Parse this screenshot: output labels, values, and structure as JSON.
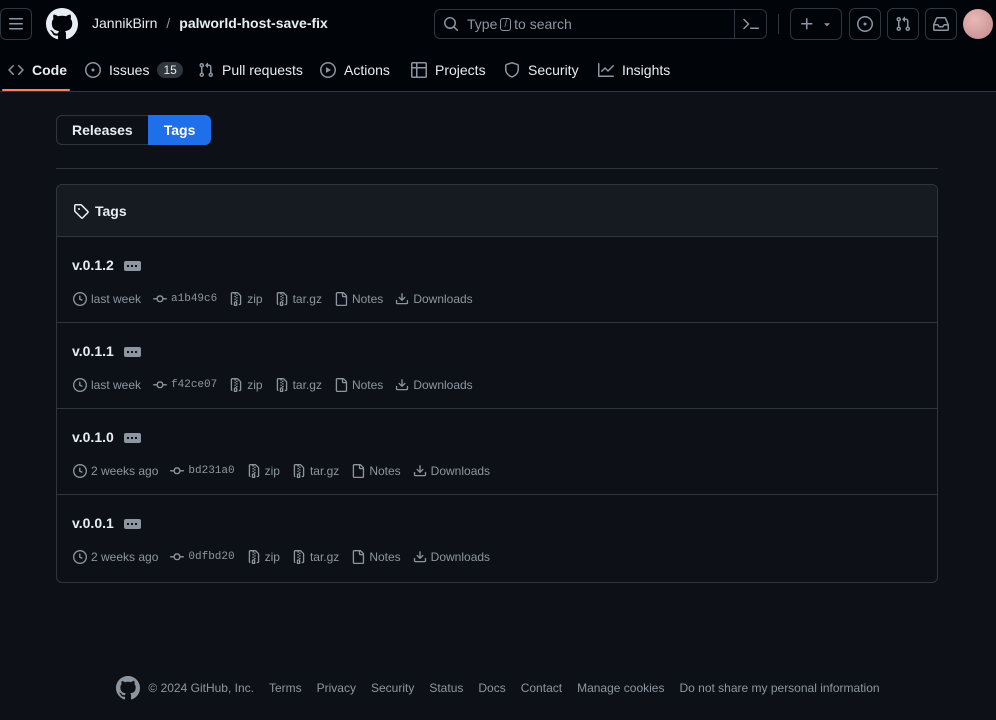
{
  "header": {
    "owner": "JannikBirn",
    "separator": "/",
    "repo": "palworld-host-save-fix",
    "search_prefix": "Type",
    "search_key": "/",
    "search_suffix": "to search"
  },
  "nav": {
    "items": [
      {
        "label": "Code",
        "icon": "code-icon",
        "active": true
      },
      {
        "label": "Issues",
        "icon": "issue-opened-icon",
        "count": "15"
      },
      {
        "label": "Pull requests",
        "icon": "git-pull-request-icon"
      },
      {
        "label": "Actions",
        "icon": "play-icon"
      },
      {
        "label": "Projects",
        "icon": "table-icon"
      },
      {
        "label": "Security",
        "icon": "shield-icon"
      },
      {
        "label": "Insights",
        "icon": "graph-icon"
      }
    ]
  },
  "tabs": {
    "releases": "Releases",
    "tags": "Tags",
    "selected": "Tags"
  },
  "box": {
    "title": "Tags"
  },
  "tags": [
    {
      "name": "v.0.1.2",
      "date": "last week",
      "commit": "a1b49c6",
      "zip": "zip",
      "targz": "tar.gz",
      "notes": "Notes",
      "downloads": "Downloads"
    },
    {
      "name": "v.0.1.1",
      "date": "last week",
      "commit": "f42ce07",
      "zip": "zip",
      "targz": "tar.gz",
      "notes": "Notes",
      "downloads": "Downloads"
    },
    {
      "name": "v.0.1.0",
      "date": "2 weeks ago",
      "commit": "bd231a0",
      "zip": "zip",
      "targz": "tar.gz",
      "notes": "Notes",
      "downloads": "Downloads"
    },
    {
      "name": "v.0.0.1",
      "date": "2 weeks ago",
      "commit": "0dfbd20",
      "zip": "zip",
      "targz": "tar.gz",
      "notes": "Notes",
      "downloads": "Downloads"
    }
  ],
  "footer": {
    "copyright": "© 2024 GitHub, Inc.",
    "links": [
      "Terms",
      "Privacy",
      "Security",
      "Status",
      "Docs",
      "Contact",
      "Manage cookies",
      "Do not share my personal information"
    ]
  },
  "colors": {
    "background": "#0d1117",
    "header_bg": "#010409",
    "accent": "#1f6feb",
    "active_underline": "#f78166",
    "border": "#30363d",
    "muted": "#8d96a0"
  }
}
